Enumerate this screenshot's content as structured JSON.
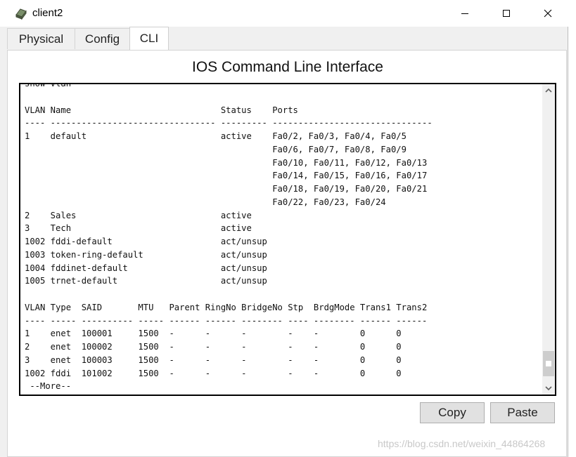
{
  "window": {
    "title": "client2",
    "icon": "router-icon"
  },
  "tabs": [
    {
      "label": "Physical",
      "active": false
    },
    {
      "label": "Config",
      "active": false
    },
    {
      "label": "CLI",
      "active": true
    }
  ],
  "panel": {
    "heading": "IOS Command Line Interface"
  },
  "console": {
    "lines": [
      "show vlan",
      "",
      "VLAN Name                             Status    Ports",
      "---- -------------------------------- --------- -------------------------------",
      "1    default                          active    Fa0/2, Fa0/3, Fa0/4, Fa0/5",
      "                                                Fa0/6, Fa0/7, Fa0/8, Fa0/9",
      "                                                Fa0/10, Fa0/11, Fa0/12, Fa0/13",
      "                                                Fa0/14, Fa0/15, Fa0/16, Fa0/17",
      "                                                Fa0/18, Fa0/19, Fa0/20, Fa0/21",
      "                                                Fa0/22, Fa0/23, Fa0/24",
      "2    Sales                            active",
      "3    Tech                             active",
      "1002 fddi-default                     act/unsup",
      "1003 token-ring-default               act/unsup",
      "1004 fddinet-default                  act/unsup",
      "1005 trnet-default                    act/unsup",
      "",
      "VLAN Type  SAID       MTU   Parent RingNo BridgeNo Stp  BrdgMode Trans1 Trans2",
      "---- ----- ---------- ----- ------ ------ -------- ---- -------- ------ ------",
      "1    enet  100001     1500  -      -      -        -    -        0      0",
      "2    enet  100002     1500  -      -      -        -    -        0      0",
      "3    enet  100003     1500  -      -      -        -    -        0      0",
      "1002 fddi  101002     1500  -      -      -        -    -        0      0",
      " --More--"
    ]
  },
  "buttons": {
    "copy": "Copy",
    "paste": "Paste"
  },
  "watermark": "https://blog.csdn.net/weixin_44864268"
}
